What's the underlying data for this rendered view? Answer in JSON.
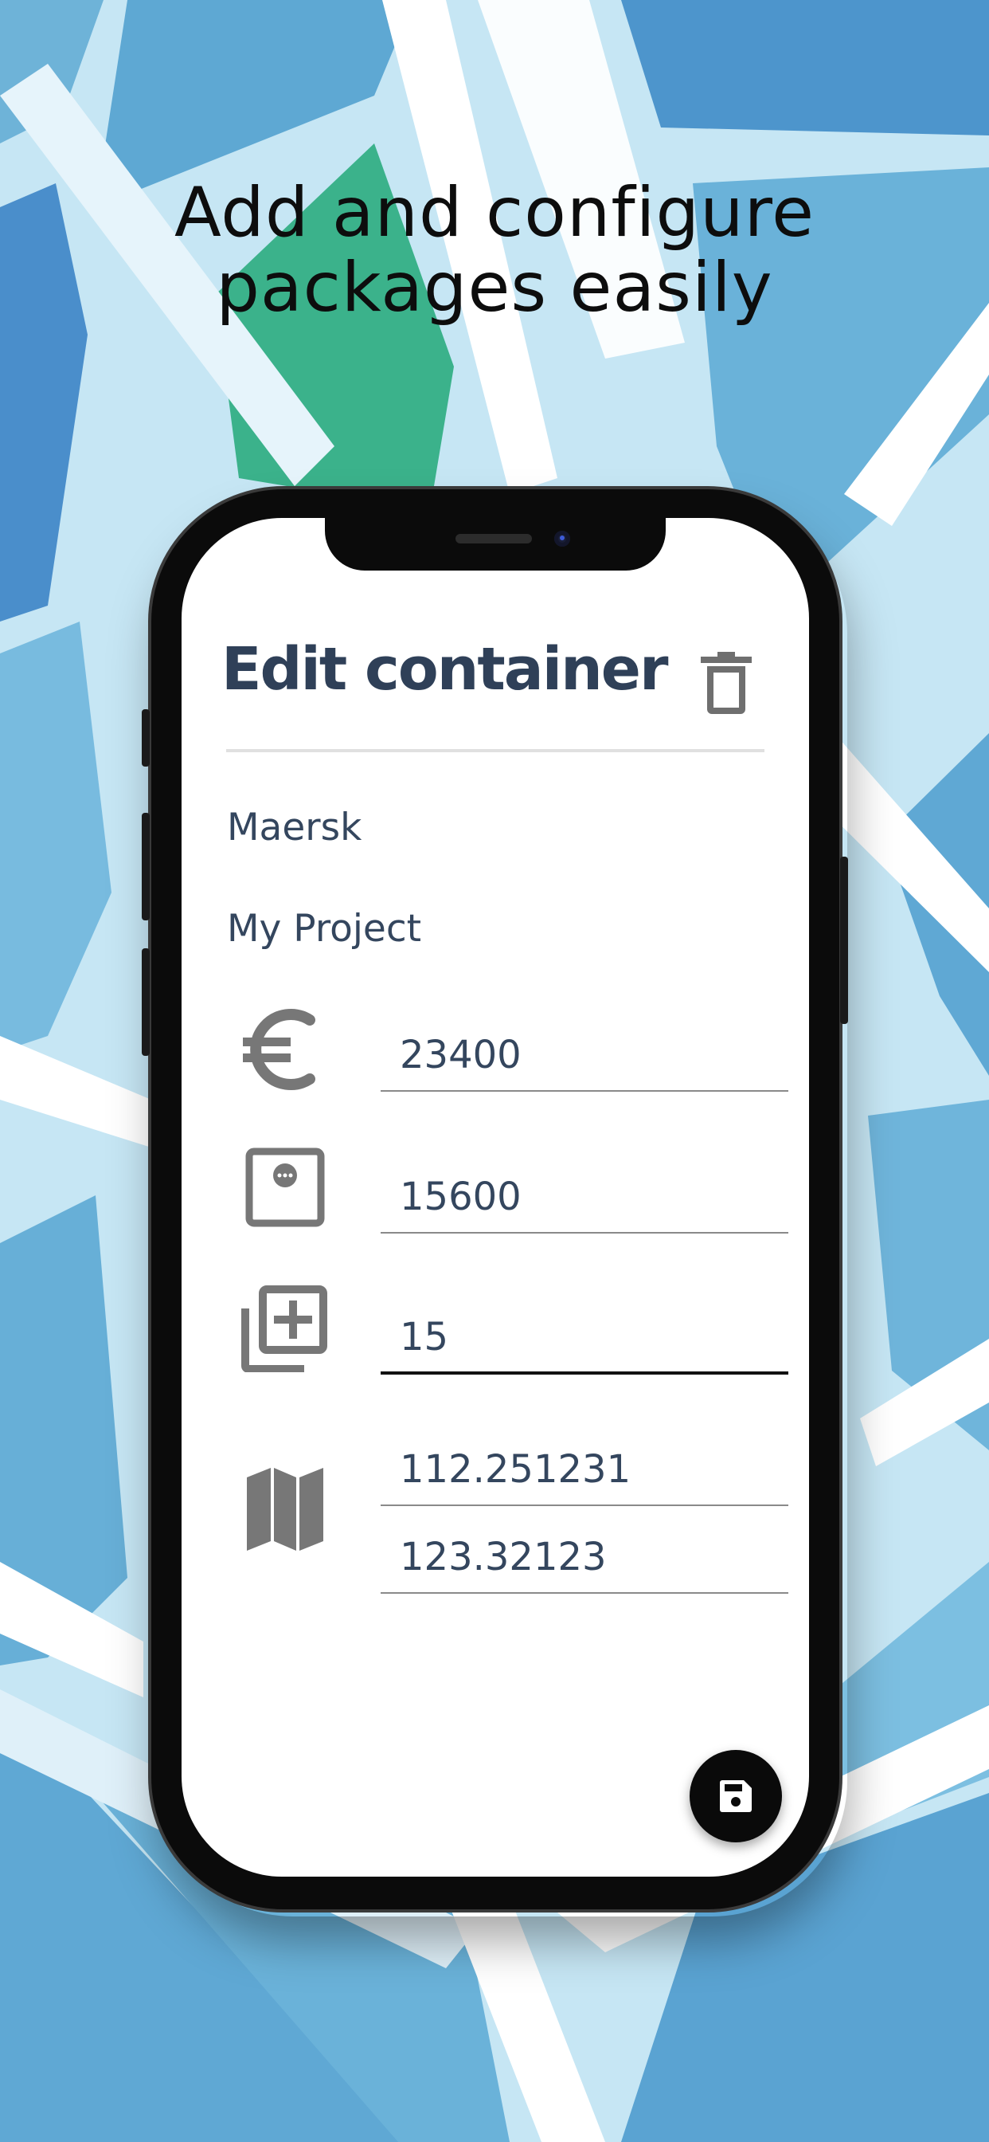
{
  "promo": {
    "headline_line1": "Add and configure",
    "headline_line2": "packages easily"
  },
  "screen": {
    "title": "Edit container",
    "company": "Maersk",
    "project": "My Project",
    "fields": {
      "price": {
        "icon": "euro-icon",
        "value": "23400"
      },
      "weight": {
        "icon": "scale-icon",
        "value": "15600"
      },
      "quantity": {
        "icon": "add-to-library-icon",
        "value": "15"
      },
      "latitude": {
        "icon": "map-icon",
        "value": "112.251231"
      },
      "longitude": {
        "value": "123.32123"
      }
    },
    "actions": {
      "delete": "trash-icon",
      "save": "save-icon"
    }
  },
  "colors": {
    "title_text": "#2f4058",
    "body_text": "#34465e",
    "icon_gray": "#777777",
    "fab_background": "#0a0a0a",
    "map_green": "#3bb28b",
    "map_blue": "#5aa6d4",
    "map_light": "#c8e7f5"
  }
}
